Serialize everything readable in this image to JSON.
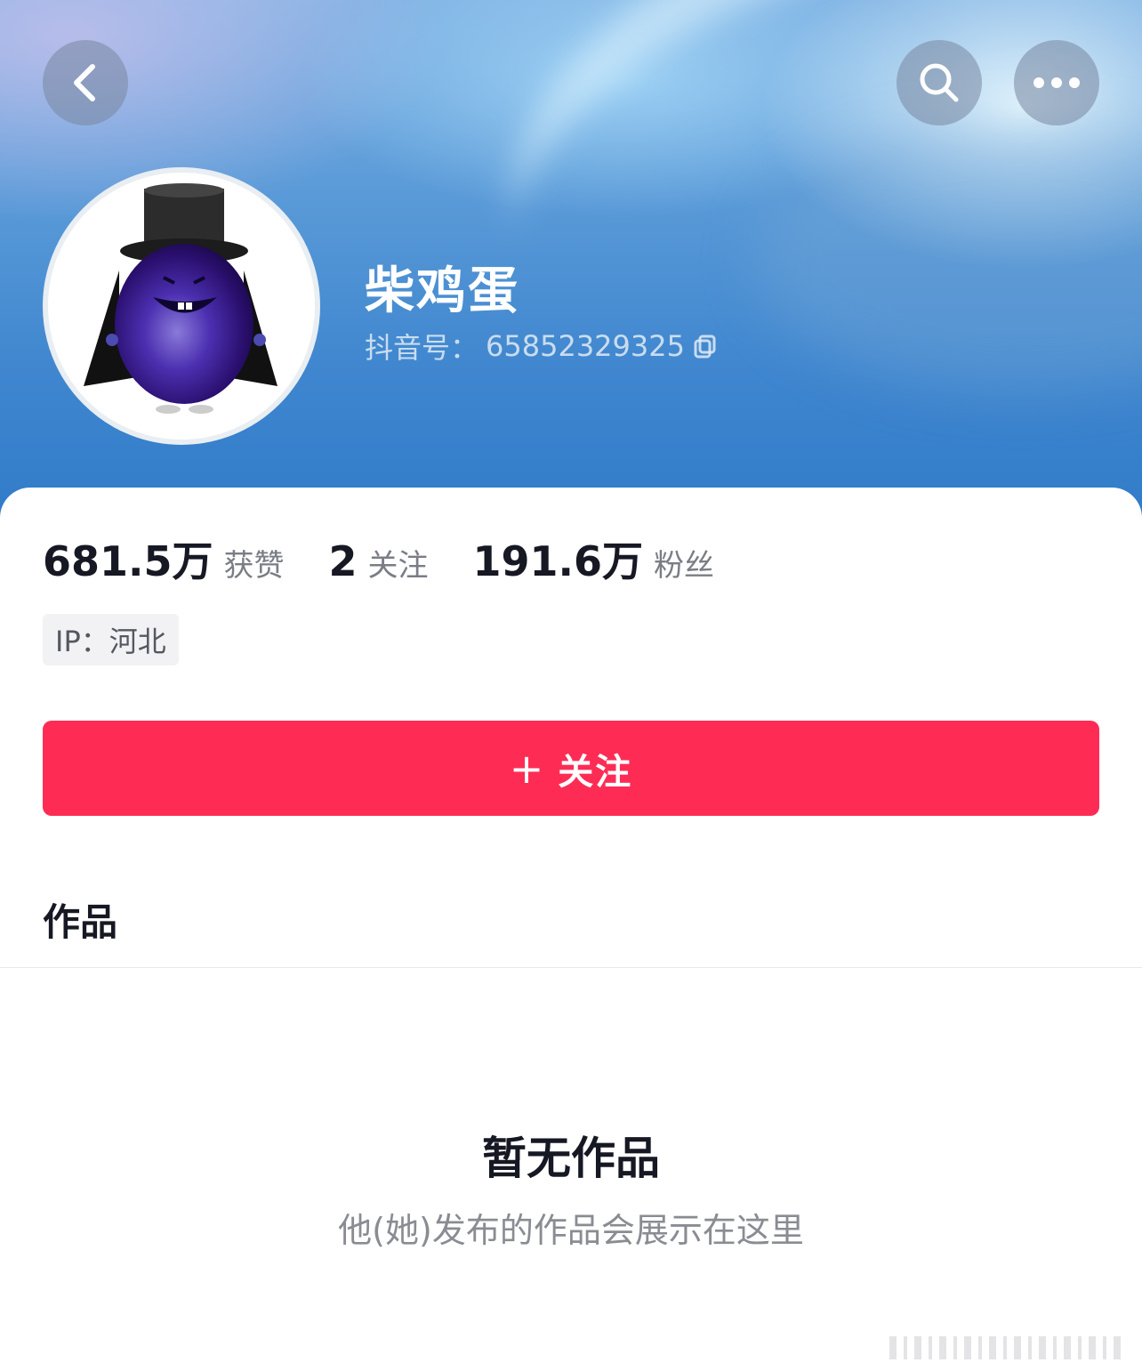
{
  "profile": {
    "nickname": "柴鸡蛋",
    "douyin_id_label": "抖音号：",
    "douyin_id": "65852329325",
    "ip_label": "IP：河北"
  },
  "stats": [
    {
      "value": "681.5万",
      "label": "获赞"
    },
    {
      "value": "2",
      "label": "关注"
    },
    {
      "value": "191.6万",
      "label": "粉丝"
    }
  ],
  "actions": {
    "follow_plus": "+",
    "follow_label": "关注"
  },
  "tabs": {
    "works": "作品"
  },
  "empty_state": {
    "title": "暂无作品",
    "subtitle": "他(她)发布的作品会展示在这里"
  },
  "icons": {
    "back": "chevron-left-icon",
    "search": "search-icon",
    "more": "more-dots-icon",
    "copy": "copy-icon",
    "avatar": "purple-egg-character-avatar"
  },
  "colors": {
    "accent": "#fe2c55",
    "header_blue": "#3f86cf",
    "text_primary": "#161823",
    "text_secondary": "#7a7d85"
  }
}
